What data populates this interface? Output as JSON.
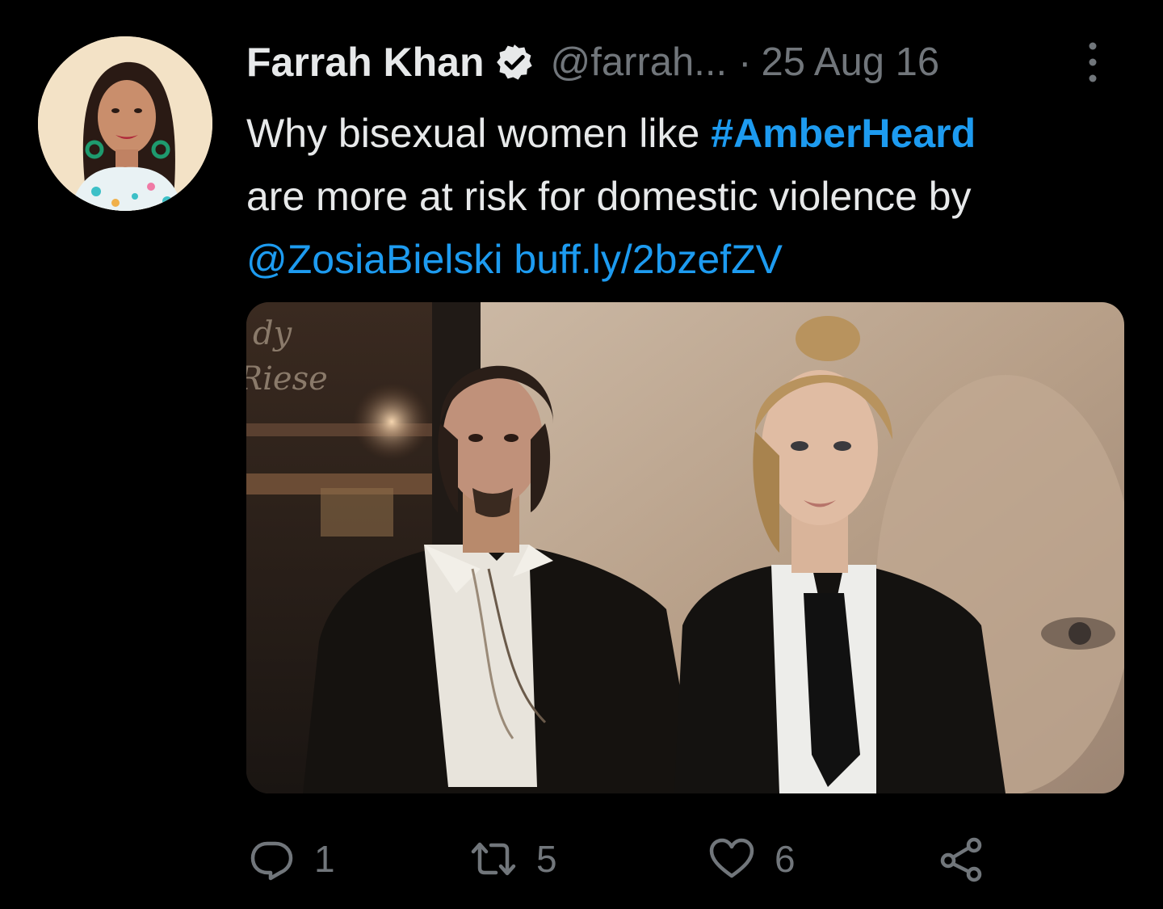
{
  "author": {
    "name": "Farrah Khan",
    "handle": "@farrah...",
    "separator": "·",
    "date": "25 Aug 16",
    "verified": true
  },
  "text": {
    "line1_plain": "Why bisexual women like ",
    "hashtag": "#AmberHeard",
    "line2": "are more at risk for domestic violence by",
    "mention": "@ZosiaBielski",
    "url": "buff.ly/2bzefZV"
  },
  "media": {
    "backdrop_text_line1": "dy",
    "backdrop_text_line2": "Riese"
  },
  "actions": {
    "replies": "1",
    "retweets": "5",
    "likes": "6"
  },
  "icons": {
    "verified": "verified-badge-icon",
    "more": "more-vertical-icon",
    "reply": "reply-icon",
    "retweet": "retweet-icon",
    "like": "heart-icon",
    "share": "share-icon"
  },
  "colors": {
    "background": "#000000",
    "text": "#e7e9ea",
    "secondary": "#71767b",
    "link": "#1d9bf0"
  }
}
